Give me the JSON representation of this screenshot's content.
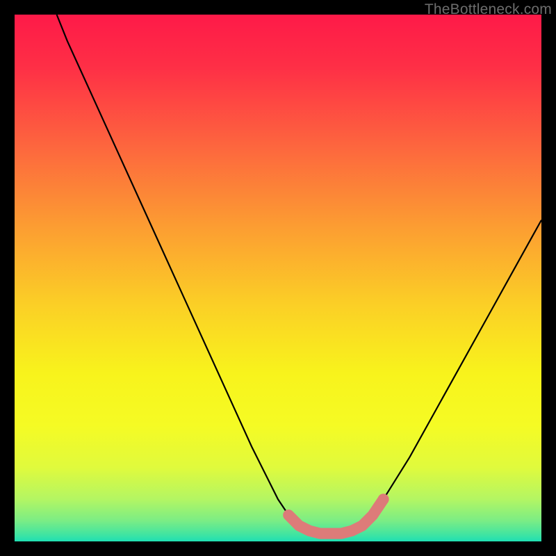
{
  "watermark": "TheBottleneck.com",
  "chart_data": {
    "type": "line",
    "title": "",
    "xlabel": "",
    "ylabel": "",
    "xlim": [
      0,
      100
    ],
    "ylim": [
      0,
      100
    ],
    "grid": false,
    "series": [
      {
        "name": "curve",
        "x": [
          8,
          10,
          15,
          20,
          25,
          30,
          35,
          40,
          45,
          50,
          52,
          54,
          56,
          58,
          60,
          62,
          64,
          66,
          68,
          70,
          75,
          80,
          85,
          90,
          95,
          100
        ],
        "y": [
          100,
          95,
          84,
          73,
          62,
          51,
          40,
          29,
          18,
          8,
          5,
          3,
          2,
          1.5,
          1.5,
          1.5,
          2,
          3,
          5,
          8,
          16,
          25,
          34,
          43,
          52,
          61
        ]
      }
    ],
    "highlight_band": {
      "name": "marker-band",
      "x": [
        52,
        54,
        56,
        58,
        60,
        62,
        64,
        66,
        68,
        70
      ],
      "y": [
        5,
        3,
        2,
        1.5,
        1.5,
        1.5,
        2,
        3,
        5,
        8
      ],
      "color": "#dd7b79"
    },
    "background_gradient": {
      "stops": [
        {
          "offset": 0.0,
          "color": "#fe1a48"
        },
        {
          "offset": 0.1,
          "color": "#fe2f46"
        },
        {
          "offset": 0.25,
          "color": "#fd663e"
        },
        {
          "offset": 0.4,
          "color": "#fc9c32"
        },
        {
          "offset": 0.55,
          "color": "#fbcf26"
        },
        {
          "offset": 0.68,
          "color": "#f8f31c"
        },
        {
          "offset": 0.78,
          "color": "#f5fb24"
        },
        {
          "offset": 0.86,
          "color": "#e0fa3d"
        },
        {
          "offset": 0.92,
          "color": "#b3f663"
        },
        {
          "offset": 0.96,
          "color": "#7ced84"
        },
        {
          "offset": 0.985,
          "color": "#45e59f"
        },
        {
          "offset": 1.0,
          "color": "#1fdfb3"
        }
      ]
    }
  }
}
